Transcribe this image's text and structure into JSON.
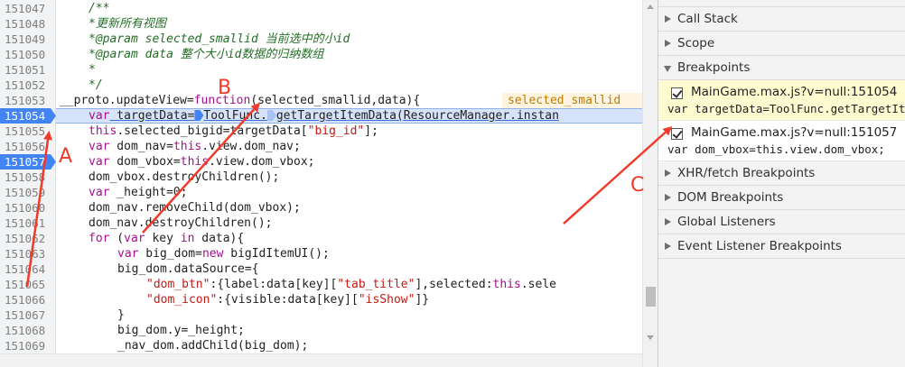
{
  "editor": {
    "rows": [
      {
        "num": "151047",
        "bp": false
      },
      {
        "num": "151048",
        "bp": false
      },
      {
        "num": "151049",
        "bp": false
      },
      {
        "num": "151050",
        "bp": false
      },
      {
        "num": "151051",
        "bp": false
      },
      {
        "num": "151052",
        "bp": false
      },
      {
        "num": "151053",
        "bp": false
      },
      {
        "num": "151054",
        "bp": true
      },
      {
        "num": "151055",
        "bp": false
      },
      {
        "num": "151056",
        "bp": false
      },
      {
        "num": "151057",
        "bp": true
      },
      {
        "num": "151058",
        "bp": false
      },
      {
        "num": "151059",
        "bp": false
      },
      {
        "num": "151060",
        "bp": false
      },
      {
        "num": "151061",
        "bp": false
      },
      {
        "num": "151062",
        "bp": false
      },
      {
        "num": "151063",
        "bp": false
      },
      {
        "num": "151064",
        "bp": false
      },
      {
        "num": "151065",
        "bp": false
      },
      {
        "num": "151066",
        "bp": false
      },
      {
        "num": "151067",
        "bp": false
      },
      {
        "num": "151068",
        "bp": false
      },
      {
        "num": "151069",
        "bp": false
      }
    ],
    "code": {
      "l0": "/**",
      "l1": "*更新所有视图",
      "l2a": "*@param selected_smallid ",
      "l2b": "当前选中的小id",
      "l3a": "*@param data ",
      "l3b": "整个大小id数据的归纳数组",
      "l4": "*",
      "l5": "*/",
      "l6a": "__proto.updateView=",
      "l6b": "function",
      "l6c": "(selected_smallid,data){",
      "l6val": "selected_smallid",
      "l7a": "var",
      "l7b": " targetData=",
      "l7c": "ToolFunc.",
      "l7d": "getTargetItemData(ResourceManager.instan",
      "l8a": "this",
      "l8b": ".selected_bigid=targetData[",
      "l8c": "\"big_id\"",
      "l8d": "];",
      "l9a": "var",
      "l9b": " dom_nav=",
      "l9c": "this",
      "l9d": ".view.dom_nav;",
      "l10a": "var",
      "l10b": " dom_vbox=",
      "l10c": "this",
      "l10d": ".view.dom_vbox;",
      "l11": "dom_vbox.destroyChildren();",
      "l12a": "var",
      "l12b": " _height=0;",
      "l13": "dom_nav.removeChild(dom_vbox);",
      "l14": "dom_nav.destroyChildren();",
      "l15a": "for",
      "l15b": " (",
      "l15c": "var",
      "l15d": " key ",
      "l15e": "in",
      "l15f": " data){",
      "l16a": "var",
      "l16b": " big_dom=",
      "l16c": "new",
      "l16d": " bigIdItemUI();",
      "l17": "big_dom.dataSource={",
      "l18a": "\"dom_btn\"",
      "l18b": ":{label:data[key][",
      "l18c": "\"tab_title\"",
      "l18d": "],selected:",
      "l18e": "this",
      "l18f": ".sele",
      "l19a": "\"dom_icon\"",
      "l19b": ":{visible:data[key][",
      "l19c": "\"isShow\"",
      "l19d": "]}",
      "l20": "}",
      "l21": "big_dom.y=_height;",
      "l22": "_nav_dom.addChild(big_dom);"
    }
  },
  "sidebar": {
    "call_stack": "Call Stack",
    "scope": "Scope",
    "breakpoints": "Breakpoints",
    "bp1_file": "MainGame.max.js?v=null:151054",
    "bp1_code": "var targetData=ToolFunc.getTargetItemData(ResourceManager.instan",
    "bp2_file": "MainGame.max.js?v=null:151057",
    "bp2_code": "var dom_vbox=this.view.dom_vbox;",
    "xhr": "XHR/fetch Breakpoints",
    "dom_bp": "DOM Breakpoints",
    "global_listeners": "Global Listeners",
    "event_listener_bp": "Event Listener Breakpoints"
  },
  "annotations": {
    "a": "A",
    "b": "B",
    "c": "C",
    "color": "#f03a2b"
  }
}
